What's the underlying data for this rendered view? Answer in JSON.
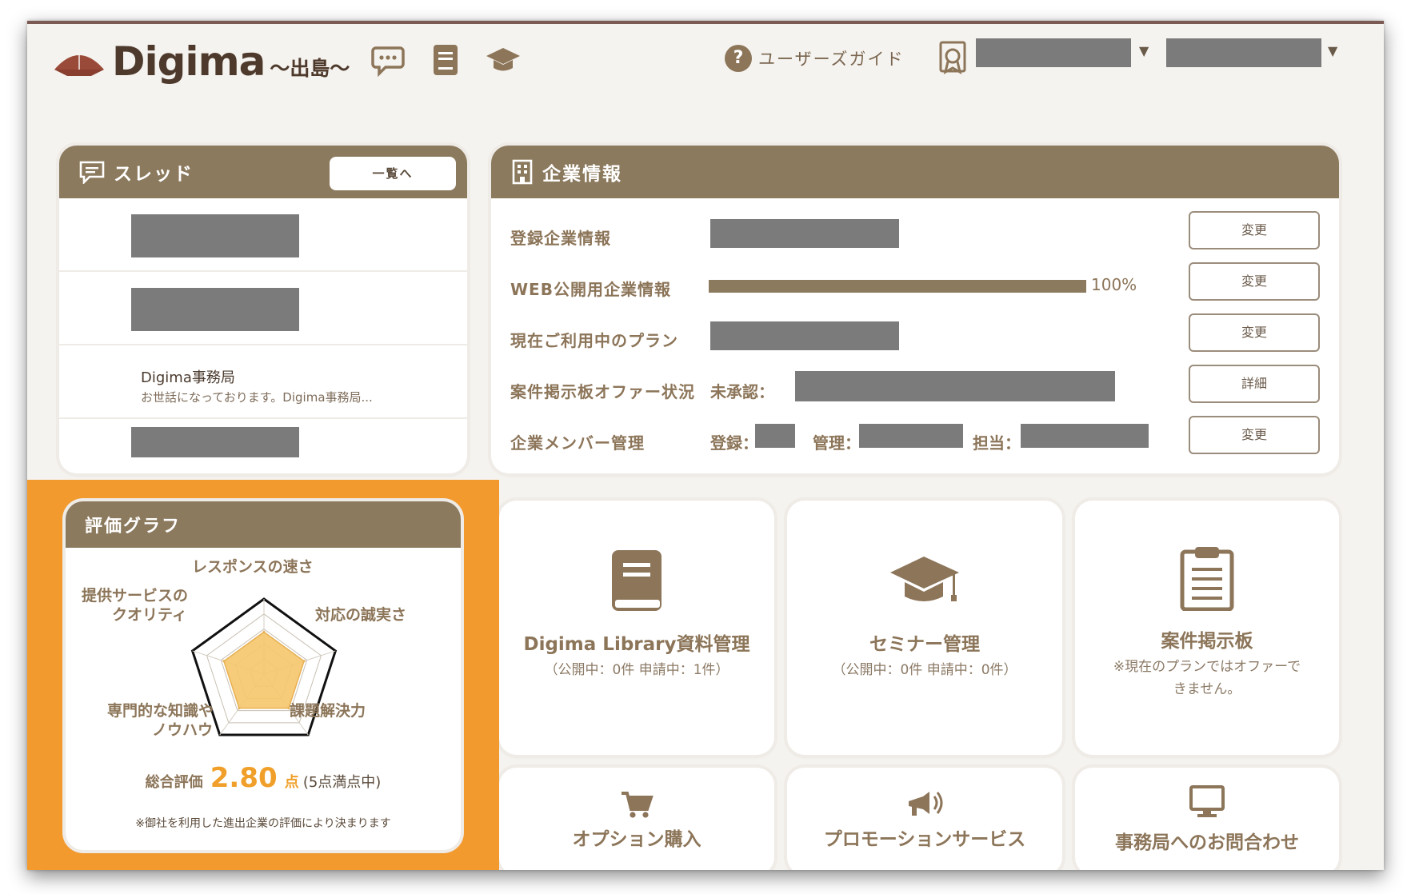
{
  "header": {
    "logo_text": "Digima",
    "logo_sub": "〜出島〜",
    "guide_icon": "?",
    "guide_label": "ユーザーズガイド",
    "dropdown_caret": "▼"
  },
  "thread_card": {
    "title": "スレッド",
    "list_button": "一覧へ",
    "visible_message": {
      "sender": "Digima事務局",
      "preview": "お世話になっております。Digima事務局..."
    }
  },
  "company_card": {
    "title": "企業情報",
    "rows": [
      {
        "label": "登録企業情報",
        "button": "変更"
      },
      {
        "label": "WEB公開用企業情報",
        "button": "変更",
        "progress_percent": 100,
        "progress_text": "100%"
      },
      {
        "label": "現在ご利用中のプラン",
        "button": "変更"
      },
      {
        "label": "案件掲示板オファー状況",
        "button": "詳細",
        "status_label": "未承認："
      },
      {
        "label": "企業メンバー管理",
        "button": "変更",
        "reg_label": "登録：",
        "admin_label": "管理：",
        "staff_label": "担当："
      }
    ]
  },
  "tiles": {
    "library": {
      "icon": "book-icon",
      "title": "Digima Library資料管理",
      "sub": "（公開中：0件 申請中：1件）"
    },
    "seminar": {
      "icon": "graduation-cap-icon",
      "title": "セミナー管理",
      "sub": "（公開中：0件 申請中：0件）"
    },
    "board": {
      "icon": "clipboard-icon",
      "title": "案件掲示板",
      "sub_line1": "※現在のプランではオファーで",
      "sub_line2": "きません。"
    },
    "option": {
      "icon": "cart-icon",
      "title": "オプション購入"
    },
    "promotion": {
      "icon": "megaphone-icon",
      "title": "プロモーションサービス"
    },
    "contact": {
      "icon": "monitor-icon",
      "title": "事務局へのお問合わせ"
    }
  },
  "rating": {
    "title": "評価グラフ",
    "axes": [
      "レスポンスの速さ",
      "対応の誠実さ",
      "課題解決力",
      "専門的な知識や",
      "ノウハウ",
      "提供サービスの",
      "クオリティ"
    ],
    "score_label": "総合評価",
    "score_value": "2.80",
    "score_unit": "点",
    "score_max": "(5点満点中)",
    "note": "※御社を利用した進出企業の評価により決まります",
    "accent_color": "#f39a2f"
  },
  "chart_data": {
    "type": "radar",
    "categories": [
      "レスポンスの速さ",
      "対応の誠実さ",
      "課題解決力",
      "専門的な知識やノウハウ",
      "提供サービスのクオリティ"
    ],
    "values": [
      2.8,
      2.8,
      2.8,
      2.8,
      2.8
    ],
    "max": 5,
    "fill_color": "#f5c66c"
  }
}
